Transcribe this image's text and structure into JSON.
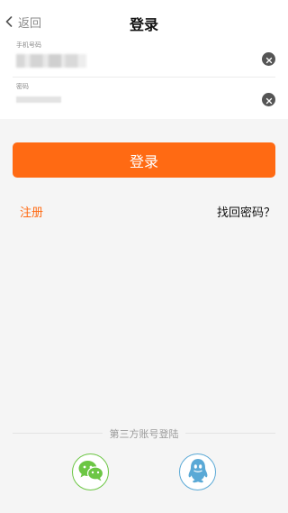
{
  "header": {
    "back_label": "返回",
    "title": "登录"
  },
  "form": {
    "phone_label": "手机号码",
    "password_label": "密码"
  },
  "login_button": "登录",
  "links": {
    "register": "注册",
    "forgot_password": "找回密码？"
  },
  "third_party": {
    "title": "第三方账号登陆",
    "wechat_color": "#6cc644",
    "qq_color": "#5aa9d6"
  },
  "colors": {
    "accent": "#ff6a13"
  },
  "icons": {
    "back": "chevron-left-icon",
    "clear": "clear-circle-icon",
    "wechat": "wechat-icon",
    "qq": "qq-penguin-icon"
  }
}
